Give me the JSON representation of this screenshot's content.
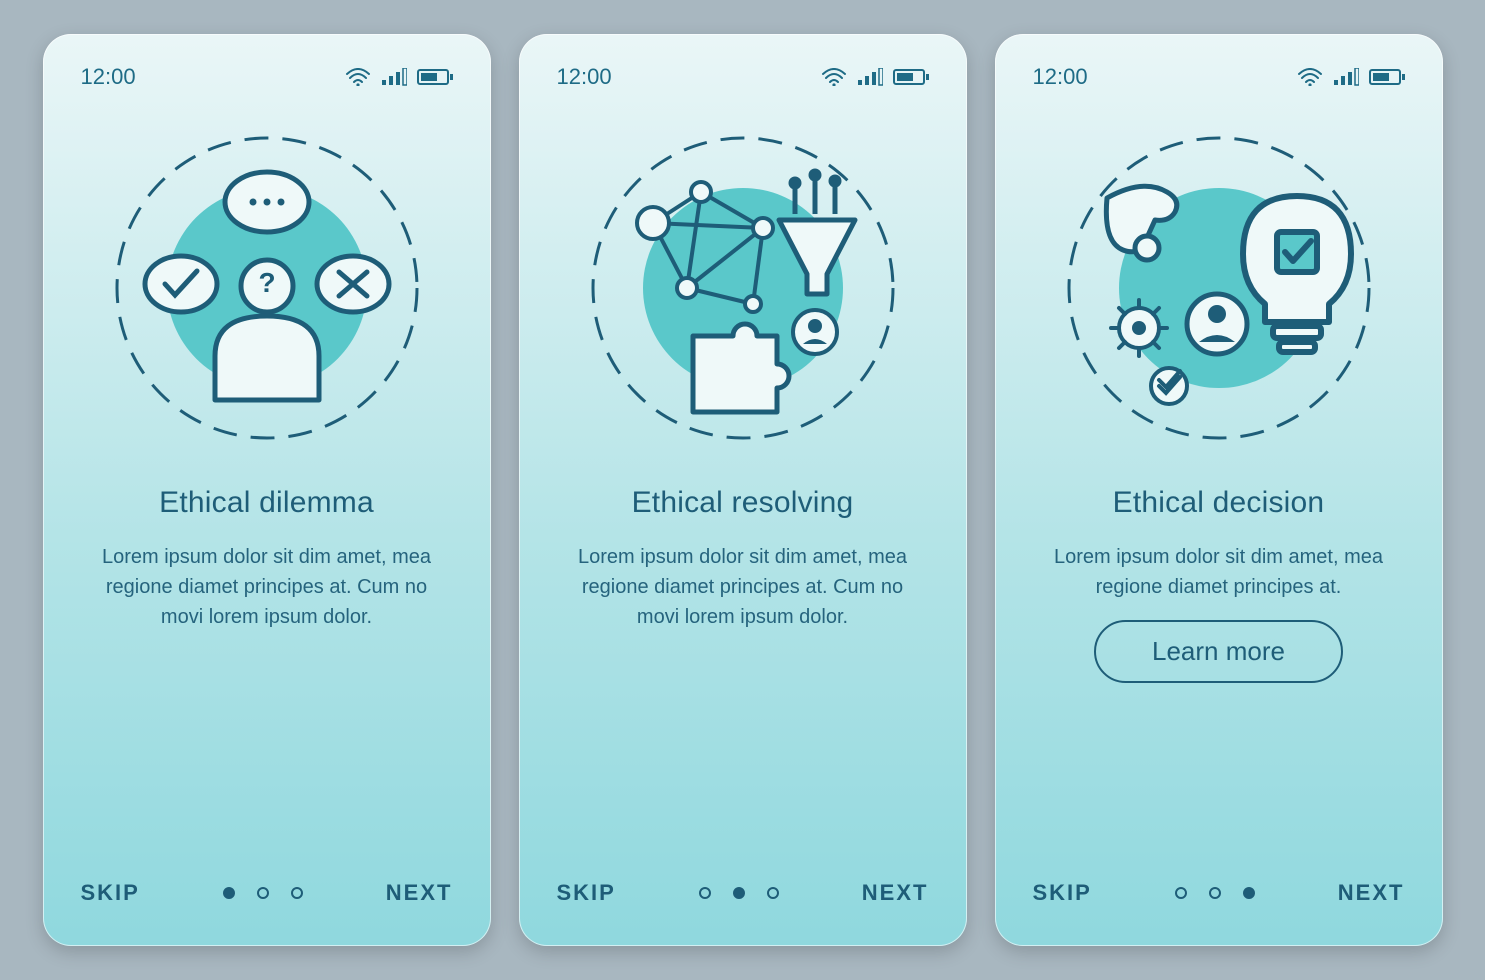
{
  "status": {
    "time": "12:00"
  },
  "nav": {
    "skip": "SKIP",
    "next": "NEXT"
  },
  "colors": {
    "stroke": "#1e5d78",
    "accent": "#5ac8ca",
    "fill_light": "#eff9f9"
  },
  "screens": [
    {
      "title": "Ethical dilemma",
      "desc": "Lorem ipsum dolor sit dim amet, mea regione diamet principes at. Cum no movi lorem ipsum dolor.",
      "active_dot": 0,
      "show_button": false,
      "icon": "dilemma"
    },
    {
      "title": "Ethical resolving",
      "desc": "Lorem ipsum dolor sit dim amet, mea regione diamet principes at. Cum no movi lorem ipsum dolor.",
      "active_dot": 1,
      "show_button": false,
      "icon": "resolving"
    },
    {
      "title": "Ethical decision",
      "desc": "Lorem ipsum dolor sit dim amet, mea regione diamet principes at.",
      "active_dot": 2,
      "show_button": true,
      "button_label": "Learn more",
      "icon": "decision"
    }
  ]
}
